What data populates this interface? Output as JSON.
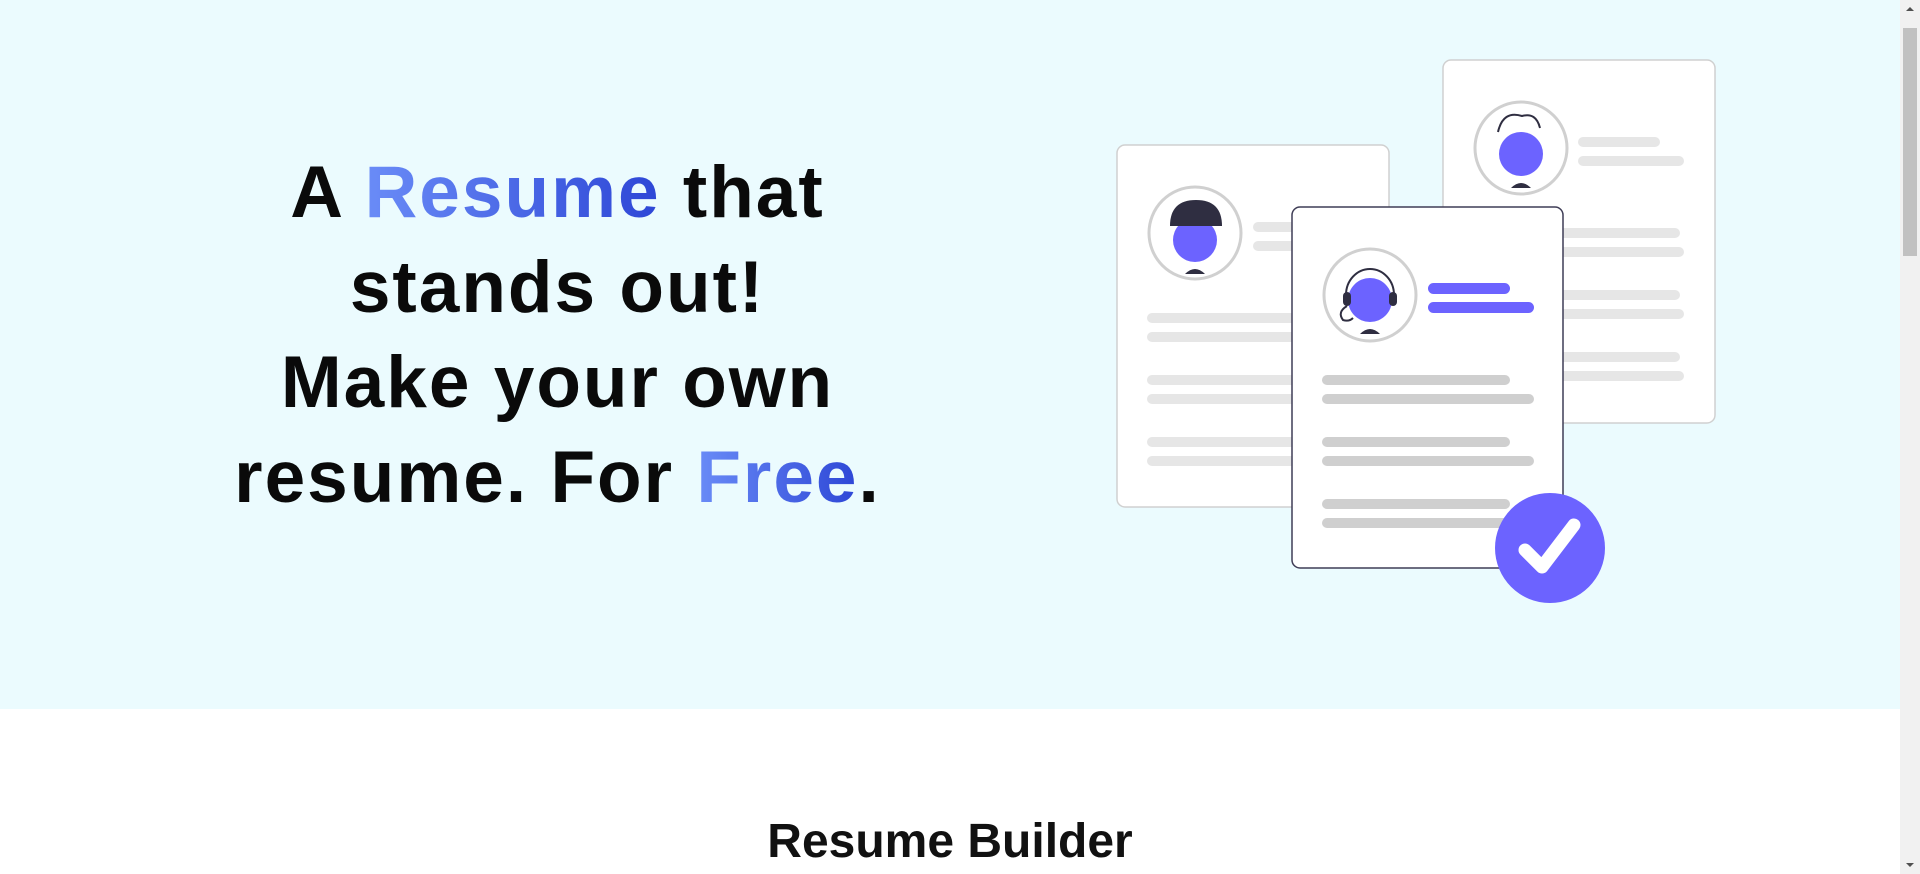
{
  "hero": {
    "line1_a": "A ",
    "line1_highlight": "Resume",
    "line1_b": " that",
    "line2": "stands out!",
    "line3": "Make your own",
    "line4_a": "resume. For ",
    "line4_highlight": "Free",
    "line4_b": ".",
    "background": "#ebfbfe",
    "accent_gradient": [
      "#6a8cf7",
      "#2d46d6"
    ]
  },
  "illustration": {
    "icons": [
      "resume-card-icon",
      "avatar-icon",
      "check-badge-icon"
    ],
    "accent": "#6c63ff"
  },
  "section": {
    "title": "Resume Builder"
  }
}
